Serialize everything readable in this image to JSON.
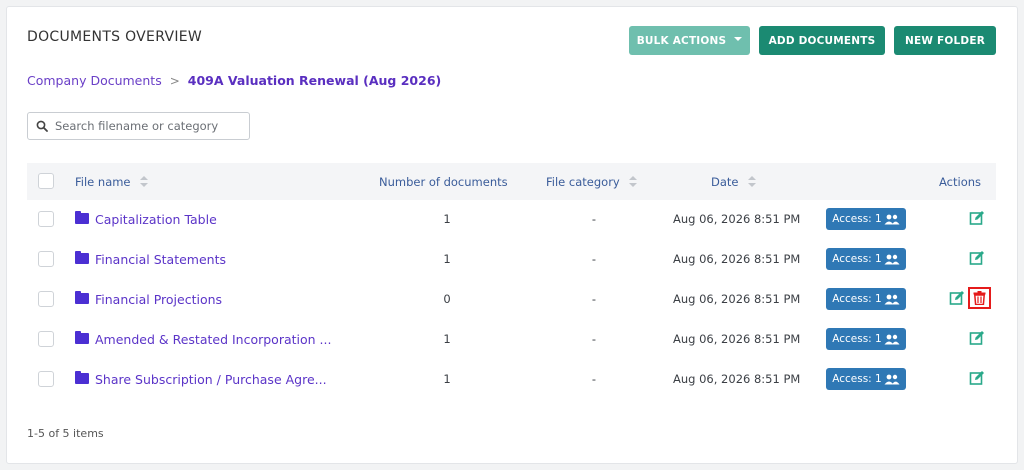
{
  "header": {
    "title": "DOCUMENTS OVERVIEW",
    "bulk_label": "BULK ACTIONS",
    "add_label": "ADD DOCUMENTS",
    "new_folder_label": "NEW FOLDER"
  },
  "breadcrumb": {
    "parent": "Company Documents",
    "separator": ">",
    "current": "409A Valuation Renewal (Aug 2026)"
  },
  "search": {
    "placeholder": "Search filename or category",
    "value": ""
  },
  "table": {
    "columns": {
      "file_name": "File name",
      "number_of_documents": "Number of documents",
      "file_category": "File category",
      "date": "Date",
      "actions": "Actions"
    },
    "rows": [
      {
        "name": "Capitalization Table",
        "count": "1",
        "category": "-",
        "date": "Aug 06, 2026 8:51 PM",
        "access": "Access: 1"
      },
      {
        "name": "Financial Statements",
        "count": "1",
        "category": "-",
        "date": "Aug 06, 2026 8:51 PM",
        "access": "Access: 1"
      },
      {
        "name": "Financial Projections",
        "count": "0",
        "category": "-",
        "date": "Aug 06, 2026 8:51 PM",
        "access": "Access: 1"
      },
      {
        "name": "Amended & Restated Incorporation ...",
        "count": "1",
        "category": "-",
        "date": "Aug 06, 2026 8:51 PM",
        "access": "Access: 1"
      },
      {
        "name": "Share Subscription / Purchase Agre...",
        "count": "1",
        "category": "-",
        "date": "Aug 06, 2026 8:51 PM",
        "access": "Access: 1"
      }
    ]
  },
  "footer": {
    "pagination": "1-5 of 5 items"
  },
  "icons": {
    "search": "search-icon",
    "folder": "folder-icon",
    "users": "users-icon",
    "edit": "edit-icon",
    "delete": "trash-icon",
    "bulk_caret": "caret-down-icon"
  },
  "colors": {
    "primary": "#1b8a72",
    "primary_light": "#6fbfae",
    "link": "#5b34c8",
    "access_badge": "#2f78b5",
    "delete_highlight": "#e51b1b"
  }
}
